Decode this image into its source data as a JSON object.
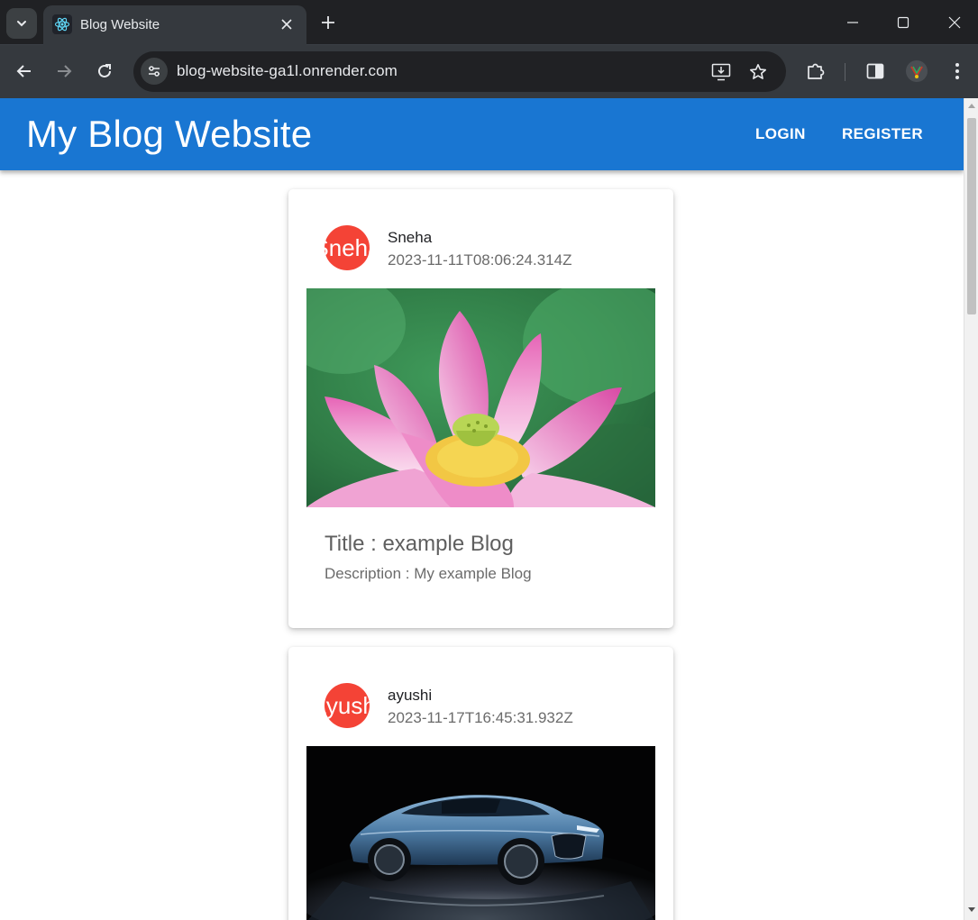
{
  "browser": {
    "tab_title": "Blog Website",
    "url": "blog-website-ga1l.onrender.com",
    "icons": {
      "tab_search": "chevron-down-icon",
      "favicon": "react-logo-icon",
      "tab_close": "close-icon",
      "new_tab": "plus-icon",
      "minimize": "minimize-icon",
      "maximize": "maximize-icon",
      "close_window": "close-icon",
      "back": "back-arrow-icon",
      "forward": "forward-arrow-icon",
      "reload": "reload-icon",
      "site_info": "tune-icon",
      "install": "install-app-icon",
      "bookmark": "star-icon",
      "extensions": "puzzle-icon",
      "side_panel": "side-panel-icon",
      "profile": "profile-avatar-icon",
      "menu": "more-vert-icon"
    }
  },
  "header": {
    "title": "My Blog Website",
    "login_label": "LOGIN",
    "register_label": "REGISTER",
    "color": "#1976d2"
  },
  "posts": [
    {
      "author": "Sneha",
      "avatar_text": "Sneha",
      "date": "2023-11-11T08:06:24.314Z",
      "image": "pink-lotus-flower",
      "title": "Title : example Blog",
      "description": "Description : My example Blog"
    },
    {
      "author": "ayushi",
      "avatar_text": "ayushi",
      "date": "2023-11-17T16:45:31.932Z",
      "image": "blue-sports-car"
    }
  ],
  "colors": {
    "avatar": "#f44336",
    "chrome_dark": "#202124",
    "chrome_toolbar": "#35393e"
  }
}
